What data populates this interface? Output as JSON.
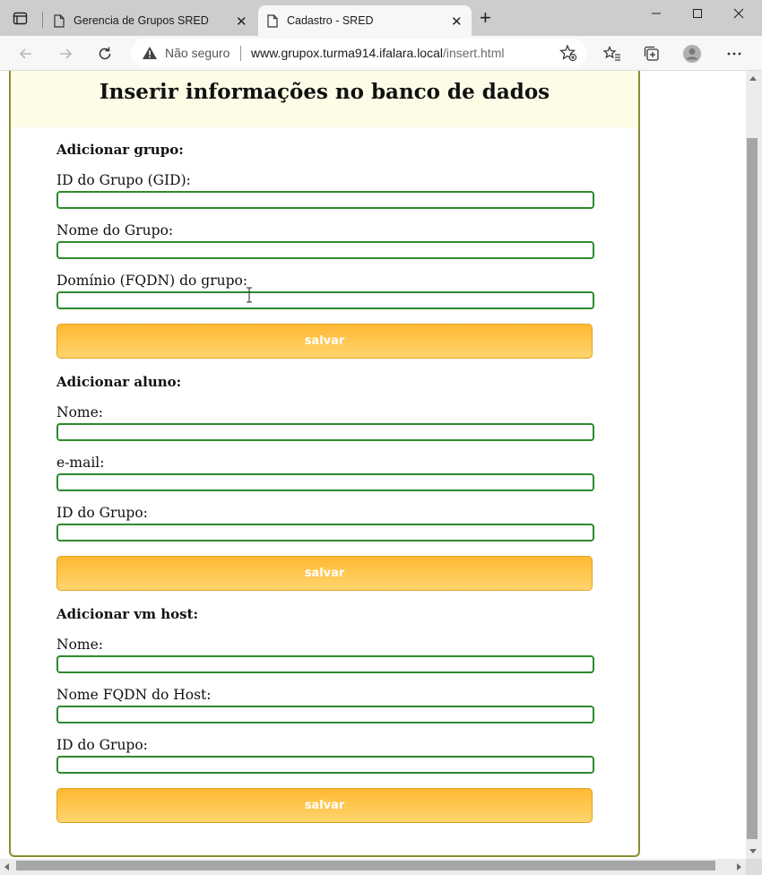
{
  "browser": {
    "tabs": [
      {
        "title": "Gerencia de Grupos SRED",
        "active": false
      },
      {
        "title": "Cadastro - SRED",
        "active": true
      }
    ],
    "security_label": "Não seguro",
    "url_host": "www.grupox.turma914.ifalara.local",
    "url_path": "/insert.html"
  },
  "page": {
    "title": "Inserir informações no banco de dados",
    "sections": [
      {
        "heading": "Adicionar grupo:",
        "fields": [
          {
            "label": "ID do Grupo (GID):",
            "value": ""
          },
          {
            "label": "Nome do Grupo:",
            "value": ""
          },
          {
            "label": "Domínio (FQDN) do grupo:",
            "value": ""
          }
        ],
        "button": "salvar"
      },
      {
        "heading": "Adicionar aluno:",
        "fields": [
          {
            "label": "Nome:",
            "value": ""
          },
          {
            "label": "e-mail:",
            "value": ""
          },
          {
            "label": "ID do Grupo:",
            "value": ""
          }
        ],
        "button": "salvar"
      },
      {
        "heading": "Adicionar vm host:",
        "fields": [
          {
            "label": "Nome:",
            "value": ""
          },
          {
            "label": "Nome FQDN do Host:",
            "value": ""
          },
          {
            "label": "ID do Grupo:",
            "value": ""
          }
        ],
        "button": "salvar"
      }
    ]
  },
  "colors": {
    "header_bg": "#fdfde7",
    "panel_border": "#8c8c2f",
    "input_border": "#2d8a2d",
    "button_gradient_top": "#ffb833",
    "button_gradient_bottom": "#ffd56e"
  }
}
